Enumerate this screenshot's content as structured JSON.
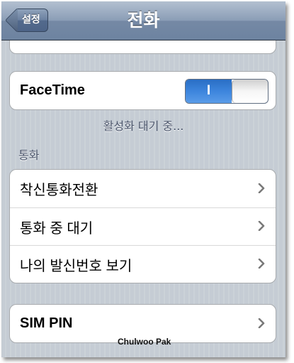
{
  "navbar": {
    "title": "전화",
    "back_label": "설정"
  },
  "facetime": {
    "label": "FaceTime",
    "toggle_on_label": "I",
    "status": "활성화 대기 중..."
  },
  "section": {
    "header": "통화"
  },
  "call_items": [
    {
      "label": "착신통화전환"
    },
    {
      "label": "통화 중 대기"
    },
    {
      "label": "나의 발신번호 보기"
    }
  ],
  "sim": {
    "label": "SIM PIN"
  },
  "watermark": "Chulwoo Pak",
  "icons": {
    "back": "back-arrow-icon",
    "chevron": "chevron-right-icon"
  },
  "colors": {
    "navbar": "#7589a5",
    "background": "#c5ccd4",
    "toggle_on": "#3d85dd"
  }
}
